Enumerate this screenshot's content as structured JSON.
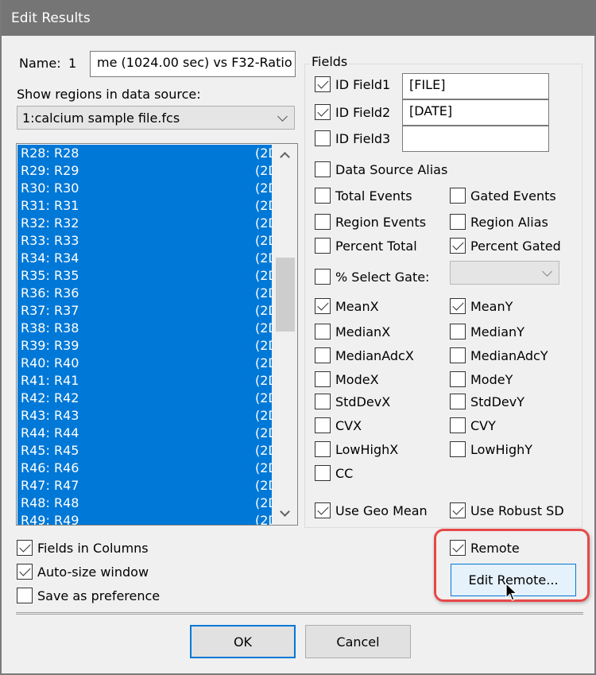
{
  "window": {
    "title": "Edit Results"
  },
  "name": {
    "label": "Name:",
    "number": "1",
    "value": "me (1024.00 sec) vs F32-Ratio"
  },
  "data_source": {
    "label": "Show regions in data source:",
    "selected": "1:calcium sample file.fcs"
  },
  "regions": {
    "selected_all_visible": true,
    "items": [
      {
        "label": "R28: R28",
        "tail": "(2D"
      },
      {
        "label": "R29: R29",
        "tail": "(2D"
      },
      {
        "label": "R30: R30",
        "tail": "(2D"
      },
      {
        "label": "R31: R31",
        "tail": "(2D"
      },
      {
        "label": "R32: R32",
        "tail": "(2D"
      },
      {
        "label": "R33: R33",
        "tail": "(2D"
      },
      {
        "label": "R34: R34",
        "tail": "(2D"
      },
      {
        "label": "R35: R35",
        "tail": "(2D"
      },
      {
        "label": "R36: R36",
        "tail": "(2D"
      },
      {
        "label": "R37: R37",
        "tail": "(2D"
      },
      {
        "label": "R38: R38",
        "tail": "(2D"
      },
      {
        "label": "R39: R39",
        "tail": "(2D"
      },
      {
        "label": "R40: R40",
        "tail": "(2D"
      },
      {
        "label": "R41: R41",
        "tail": "(2D"
      },
      {
        "label": "R42: R42",
        "tail": "(2D"
      },
      {
        "label": "R43: R43",
        "tail": "(2D"
      },
      {
        "label": "R44: R44",
        "tail": "(2D"
      },
      {
        "label": "R45: R45",
        "tail": "(2D"
      },
      {
        "label": "R46: R46",
        "tail": "(2D"
      },
      {
        "label": "R47: R47",
        "tail": "(2D"
      },
      {
        "label": "R48: R48",
        "tail": "(2D"
      },
      {
        "label": "R49: R49",
        "tail": "(2D"
      }
    ]
  },
  "fields": {
    "title": "Fields",
    "id_fields": [
      {
        "label": "ID Field1",
        "checked": true,
        "value": "[FILE]"
      },
      {
        "label": "ID Field2",
        "checked": true,
        "value": "[DATE]"
      },
      {
        "label": "ID Field3",
        "checked": false,
        "value": ""
      }
    ],
    "data_source_alias": {
      "label": "Data Source Alias",
      "checked": false
    },
    "total_events": {
      "label": "Total Events",
      "checked": false
    },
    "gated_events": {
      "label": "Gated Events",
      "checked": false
    },
    "region_events": {
      "label": "Region Events",
      "checked": false
    },
    "region_alias": {
      "label": "Region Alias",
      "checked": false
    },
    "percent_total": {
      "label": "Percent Total",
      "checked": false
    },
    "percent_gated": {
      "label": "Percent Gated",
      "checked": true
    },
    "select_gate": {
      "label": "% Select Gate:",
      "checked": false,
      "selected": ""
    },
    "stats": [
      {
        "x": {
          "label": "MeanX",
          "checked": true
        },
        "y": {
          "label": "MeanY",
          "checked": true
        }
      },
      {
        "x": {
          "label": "MedianX",
          "checked": false
        },
        "y": {
          "label": "MedianY",
          "checked": false
        }
      },
      {
        "x": {
          "label": "MedianAdcX",
          "checked": false
        },
        "y": {
          "label": "MedianAdcY",
          "checked": false
        }
      },
      {
        "x": {
          "label": "ModeX",
          "checked": false
        },
        "y": {
          "label": "ModeY",
          "checked": false
        }
      },
      {
        "x": {
          "label": "StdDevX",
          "checked": false
        },
        "y": {
          "label": "StdDevY",
          "checked": false
        }
      },
      {
        "x": {
          "label": "CVX",
          "checked": false
        },
        "y": {
          "label": "CVY",
          "checked": false
        }
      },
      {
        "x": {
          "label": "LowHighX",
          "checked": false
        },
        "y": {
          "label": "LowHighY",
          "checked": false
        }
      }
    ],
    "cc": {
      "label": "CC",
      "checked": false
    },
    "use_geo_mean": {
      "label": "Use Geo Mean",
      "checked": true
    },
    "use_robust_sd": {
      "label": "Use Robust SD",
      "checked": true
    }
  },
  "options": {
    "fields_in_columns": {
      "label": "Fields in Columns",
      "checked": true
    },
    "auto_size_window": {
      "label": "Auto-size window",
      "checked": true
    },
    "save_as_preference": {
      "label": "Save as preference",
      "checked": false
    },
    "remote": {
      "label": "Remote",
      "checked": true
    },
    "edit_remote_label": "Edit Remote..."
  },
  "buttons": {
    "ok": "OK",
    "cancel": "Cancel"
  }
}
